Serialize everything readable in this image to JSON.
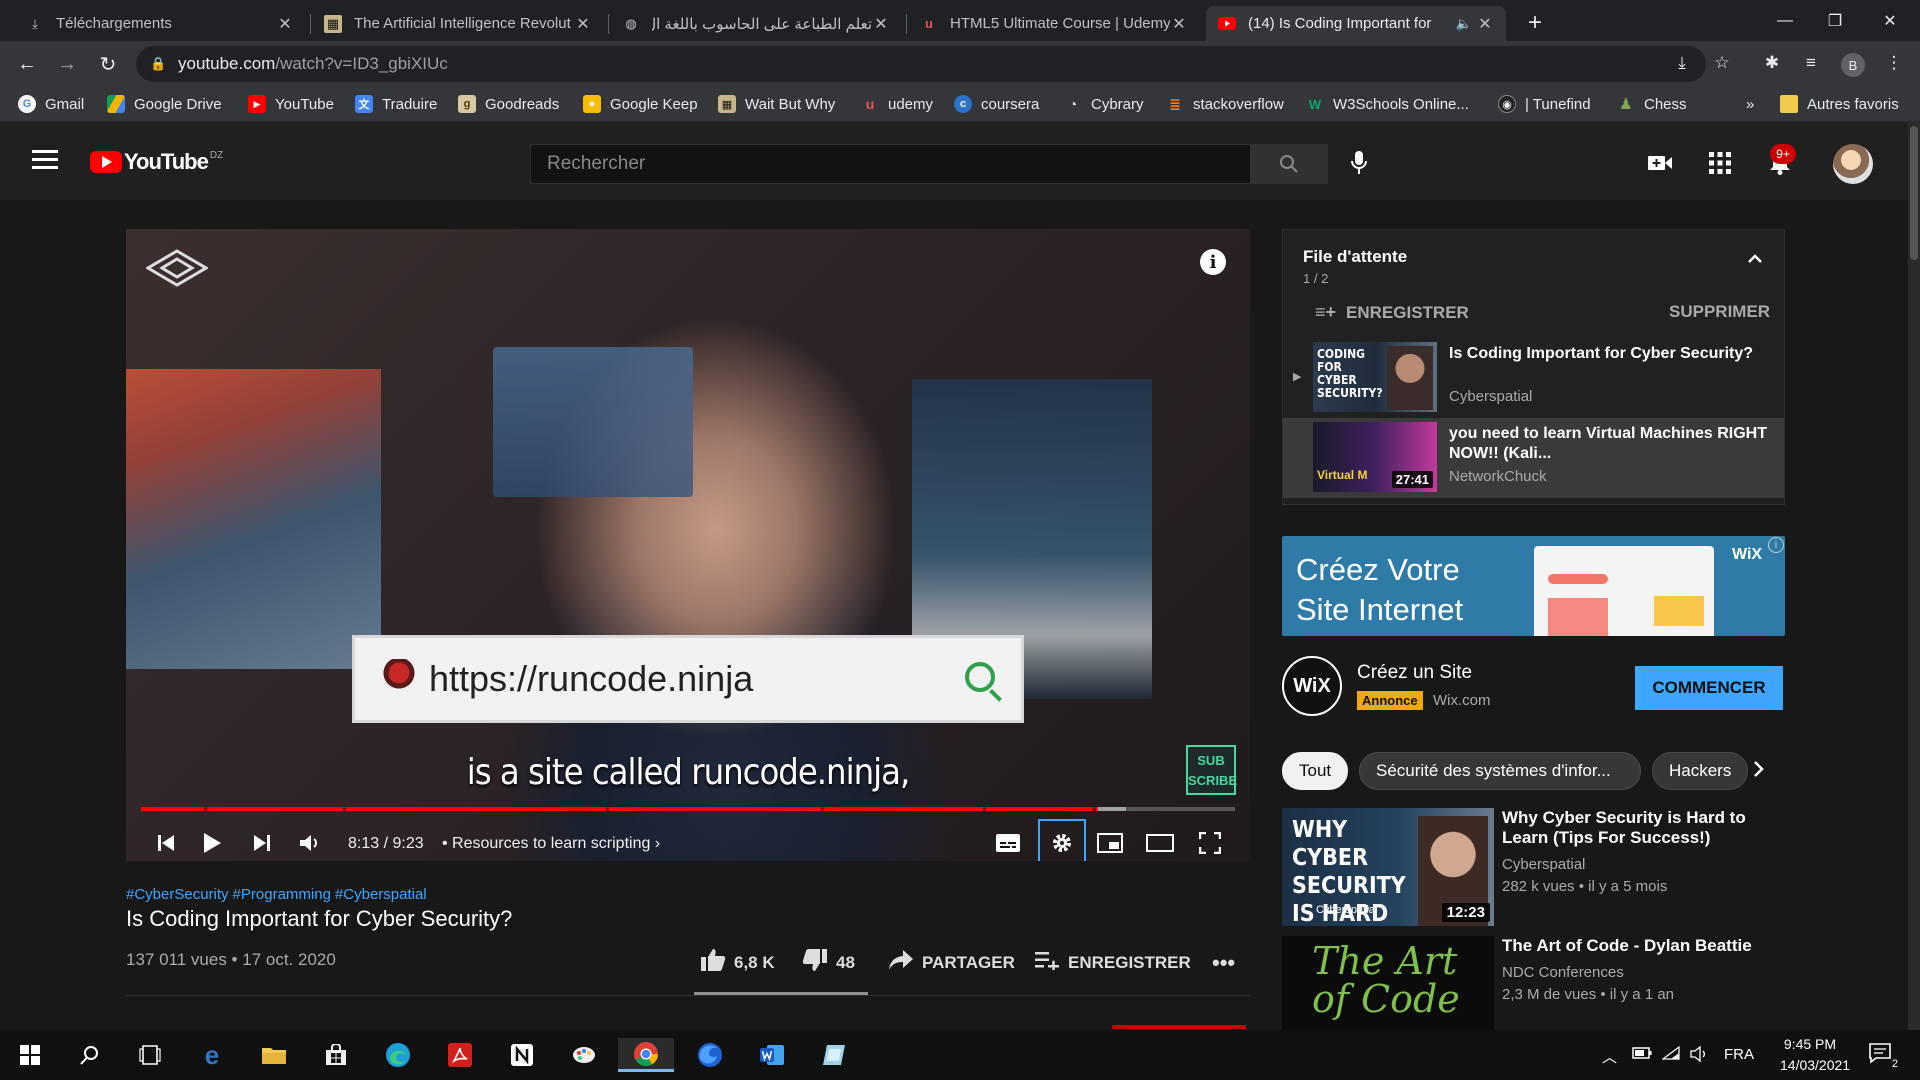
{
  "browser": {
    "tabs": [
      {
        "title": "Téléchargements",
        "icon": "download-icon"
      },
      {
        "title": "The Artificial Intelligence Revolut",
        "icon": "wbw-favicon"
      },
      {
        "title": "تعلم الطباعة على الحاسوب باللغة ال",
        "icon": "globe-icon"
      },
      {
        "title": "HTML5 Ultimate Course | Udemy",
        "icon": "udemy-favicon"
      },
      {
        "title": "(14) Is Coding Important for",
        "icon": "youtube-favicon",
        "active": true
      }
    ],
    "url_host": "youtube.com",
    "url_path": "/watch?v=ID3_gbiXIUc",
    "profile_letter": "B",
    "bookmarks": [
      {
        "label": "Gmail",
        "icon": "google-icon",
        "color": "#4285f4"
      },
      {
        "label": "Google Drive",
        "icon": "drive-icon",
        "color": "#f4b400"
      },
      {
        "label": "YouTube",
        "icon": "youtube-icon",
        "color": "#ff0000"
      },
      {
        "label": "Traduire",
        "icon": "translate-icon",
        "color": "#4285f4"
      },
      {
        "label": "Goodreads",
        "icon": "goodreads-icon",
        "color": "#d8c7a3"
      },
      {
        "label": "Google Keep",
        "icon": "keep-icon",
        "color": "#fbbc04"
      },
      {
        "label": "Wait But Why",
        "icon": "wbw-icon",
        "color": "#8a8a8a"
      },
      {
        "label": "udemy",
        "icon": "udemy-icon",
        "color": "#ec5252"
      },
      {
        "label": "coursera",
        "icon": "coursera-icon",
        "color": "#2a73cc"
      },
      {
        "label": "Cybrary",
        "icon": "cybrary-icon",
        "color": "#444444"
      },
      {
        "label": "stackoverflow",
        "icon": "stackoverflow-icon",
        "color": "#f48024"
      },
      {
        "label": "W3Schools Online...",
        "icon": "w3schools-icon",
        "color": "#04aa6d"
      },
      {
        "label": "| Tunefind",
        "icon": "tunefind-icon",
        "color": "#222222"
      },
      {
        "label": "Chess",
        "icon": "chess-icon",
        "color": "#7fa650"
      }
    ],
    "more_bookmarks": "»",
    "other_bookmarks": "Autres favoris"
  },
  "youtube": {
    "logo_text": "YouTube",
    "country": "DZ",
    "search_placeholder": "Rechercher",
    "notif_count": "9+"
  },
  "player": {
    "overlay_url": "https://runcode.ninja",
    "caption": "is a site called runcode.ninja,",
    "sub_badge_1": "SUB",
    "sub_badge_2": "SCRIBE",
    "info": "i",
    "time": "8:13 / 9:23",
    "chapter": "Resources to learn scripting",
    "played_fraction": 0.875,
    "loaded_fraction": 0.9,
    "chapter_gaps": [
      0.058,
      0.185,
      0.425,
      0.622,
      0.77,
      0.87
    ]
  },
  "video": {
    "hashtags": [
      "#CyberSecurity",
      "#Programming",
      "#Cyberspatial"
    ],
    "title": "Is Coding Important for Cyber Security?",
    "views": "137 011 vues",
    "date": "17 oct. 2020",
    "likes": "6,8 K",
    "dislikes": "48",
    "share": "PARTAGER",
    "save": "ENREGISTRER"
  },
  "queue": {
    "title": "File d'attente",
    "count": "1 / 2",
    "save": "ENREGISTRER",
    "delete": "SUPPRIMER",
    "items": [
      {
        "title": "Is Coding Important for Cyber Security?",
        "channel": "Cyberspatial",
        "thumb_text": "CODING FOR CYBER SECURITY?"
      },
      {
        "title": "you need to learn Virtual Machines RIGHT NOW!! (Kali...",
        "channel": "NetworkChuck",
        "duration": "27:41",
        "thumb_text": "Virtual M"
      }
    ]
  },
  "ad": {
    "banner_line1": "Créez Votre",
    "banner_line2": "Site Internet",
    "banner_brand": "WiX",
    "logo": "WiX",
    "title": "Créez un Site",
    "badge": "Annonce",
    "domain": "Wix.com",
    "cta": "COMMENCER"
  },
  "chips": [
    "Tout",
    "Sécurité des systèmes d'infor...",
    "Hackers"
  ],
  "recommendations": [
    {
      "title": "Why Cyber Security is Hard to Learn (Tips For Success!)",
      "channel": "Cyberspatial",
      "stats": "282 k vues • il y a 5 mois",
      "duration": "12:23",
      "thumb_text": "WHY CYBER SECURITY IS HARD",
      "thumb_sub": "Cyberspatial"
    },
    {
      "title": "The Art of Code - Dylan Beattie",
      "channel": "NDC Conferences",
      "stats": "2,3 M de vues • il y a 1 an",
      "thumb_text": "The Art of Code"
    }
  ],
  "taskbar": {
    "lang": "FRA",
    "time": "9:45 PM",
    "date": "14/03/2021",
    "notifications": "2"
  }
}
